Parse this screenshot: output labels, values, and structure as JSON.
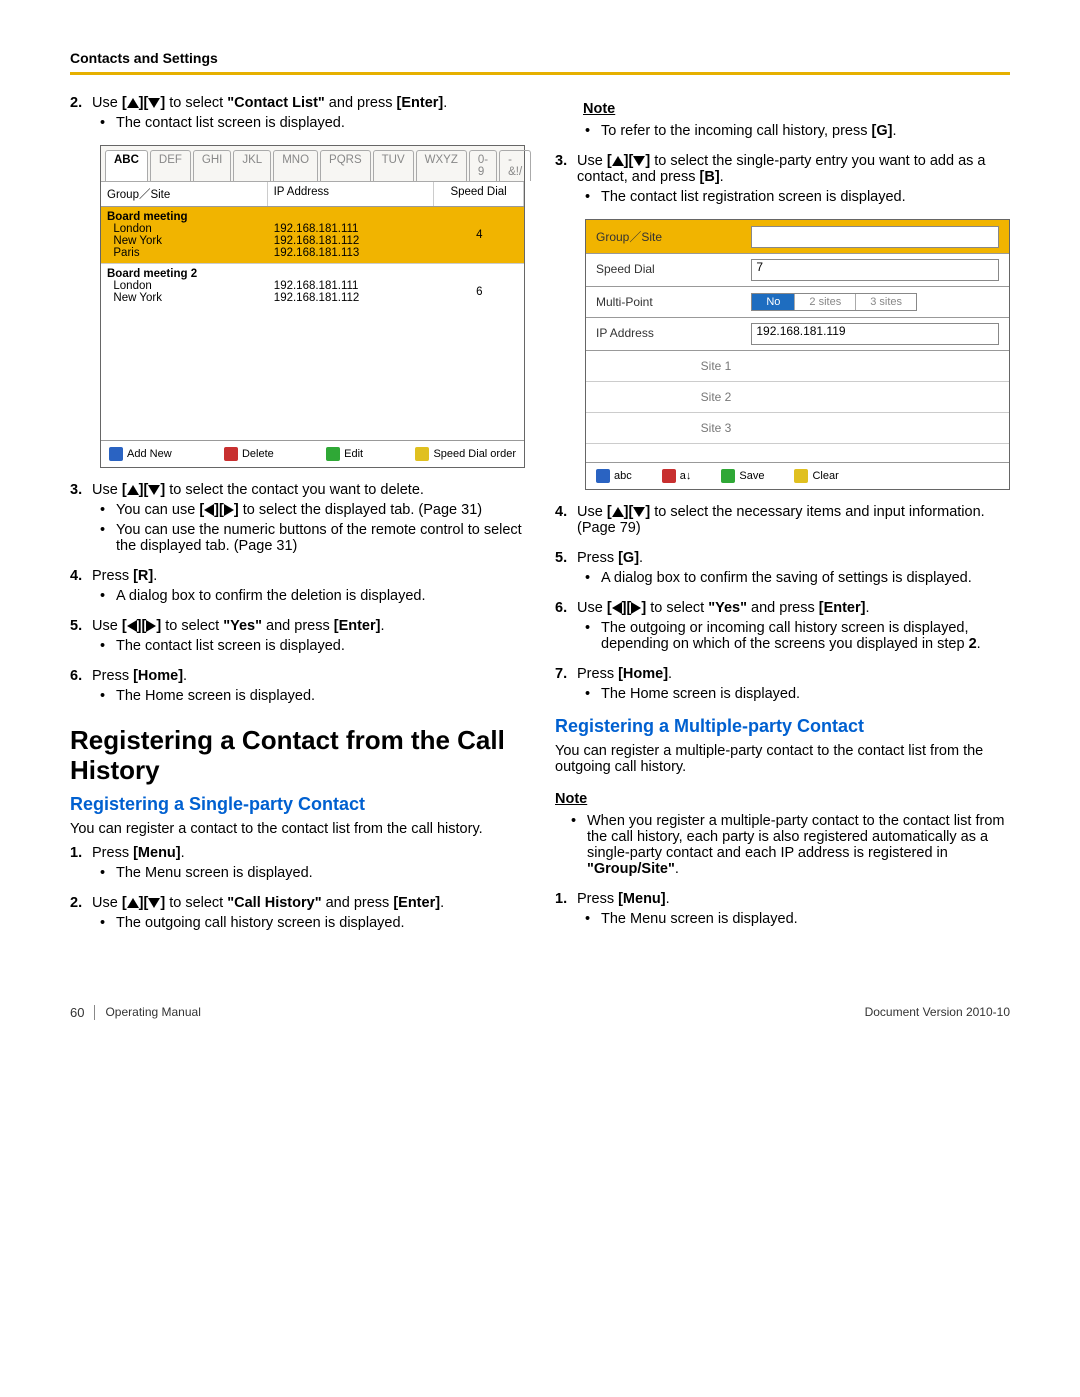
{
  "header": {
    "section_title": "Contacts and Settings"
  },
  "arrows": {
    "up": "▲",
    "down": "▼",
    "left": "◀",
    "right": "▶"
  },
  "left": {
    "step2": {
      "num": "2.",
      "pre": "Use ",
      "mid": " to select ",
      "target": "\"Contact List\"",
      "post": " and press ",
      "key": "[Enter]",
      "end": "."
    },
    "step2_bullet": "The contact list screen is displayed.",
    "ss1": {
      "tabs": [
        "ABC",
        "DEF",
        "GHI",
        "JKL",
        "MNO",
        "PQRS",
        "TUV",
        "WXYZ",
        "0-9",
        "-&!/"
      ],
      "cols": [
        "Group／Site",
        "IP Address",
        "Speed Dial"
      ],
      "row1": {
        "group": "Board meeting",
        "sites": [
          "London",
          "New York",
          "Paris"
        ],
        "ips": [
          "192.168.181.111",
          "192.168.181.112",
          "192.168.181.113"
        ],
        "sd": "4"
      },
      "row2": {
        "group": "Board meeting 2",
        "sites": [
          "London",
          "New York"
        ],
        "ips": [
          "192.168.181.111",
          "192.168.181.112"
        ],
        "sd": "6"
      },
      "btns": {
        "b": "Add New",
        "r": "Delete",
        "g": "Edit",
        "y": "Speed Dial order"
      }
    },
    "step3": {
      "num": "3.",
      "pre": "Use ",
      "post": " to select the contact you want to delete."
    },
    "step3_b1_pre": "You can use ",
    "step3_b1_post": " to select the displayed tab. (Page 31)",
    "step3_b2": "You can use the numeric buttons of the remote control to select the displayed tab. (Page 31)",
    "step4": {
      "num": "4.",
      "text": "Press ",
      "key": "[R]",
      "end": "."
    },
    "step4_b": "A dialog box to confirm the deletion is displayed.",
    "step5": {
      "num": "5.",
      "pre": "Use ",
      "mid": " to select ",
      "target": "\"Yes\"",
      "post": " and press ",
      "key": "[Enter]",
      "end": "."
    },
    "step5_b": "The contact list screen is displayed.",
    "step6": {
      "num": "6.",
      "text": "Press ",
      "key": "[Home]",
      "end": "."
    },
    "step6_b": "The Home screen is displayed.",
    "h1": "Registering a Contact from the Call History",
    "h2": "Registering a Single-party Contact",
    "intro": "You can register a contact to the contact list from the call history.",
    "s1": {
      "num": "1.",
      "text": "Press ",
      "key": "[Menu]",
      "end": "."
    },
    "s1_b": "The Menu screen is displayed.",
    "s2": {
      "num": "2.",
      "pre": "Use ",
      "mid": " to select ",
      "target": "\"Call History\"",
      "post": " and press ",
      "key": "[Enter]",
      "end": "."
    },
    "s2_b": "The outgoing call history screen is displayed."
  },
  "right": {
    "note": "Note",
    "note_b_pre": "To refer to the incoming call history, press ",
    "note_b_key": "[G]",
    "note_b_end": ".",
    "step3": {
      "num": "3.",
      "pre": "Use ",
      "mid": " to select the single-party entry you want to add as a contact, and press ",
      "key": "[B]",
      "end": "."
    },
    "step3_b": "The contact list registration screen is displayed.",
    "ss2": {
      "rows": [
        {
          "label": "Group／Site",
          "val": ""
        },
        {
          "label": "Speed Dial",
          "val": "7"
        },
        {
          "label": "Multi-Point",
          "seg": [
            "No",
            "2 sites",
            "3 sites"
          ]
        },
        {
          "label": "IP Address",
          "val": "192.168.181.119"
        }
      ],
      "sites": [
        "Site 1",
        "Site 2",
        "Site 3"
      ],
      "btns": {
        "b": "abc",
        "r": "a↓",
        "g": "Save",
        "y": "Clear"
      }
    },
    "step4": {
      "num": "4.",
      "pre": "Use ",
      "post": " to select the necessary items and input information. (Page 79)"
    },
    "step5": {
      "num": "5.",
      "text": "Press ",
      "key": "[G]",
      "end": "."
    },
    "step5_b": "A dialog box to confirm the saving of settings is displayed.",
    "step6": {
      "num": "6.",
      "pre": "Use ",
      "mid": " to select ",
      "target": "\"Yes\"",
      "post": " and press ",
      "key": "[Enter]",
      "end": "."
    },
    "step6_b": "The outgoing or incoming call history screen is displayed, depending on which of the screens you displayed in step ",
    "step6_b_key": "2",
    "step6_b_end": ".",
    "step7": {
      "num": "7.",
      "text": "Press ",
      "key": "[Home]",
      "end": "."
    },
    "step7_b": "The Home screen is displayed.",
    "h2": "Registering a Multiple-party Contact",
    "intro": "You can register a multiple-party contact to the contact list from the outgoing call history.",
    "note2": "Note",
    "note2_b": "When you register a multiple-party contact to the contact list from the call history, each party is also registered automatically as a single-party contact and each IP address is registered in ",
    "note2_key": "\"Group/Site\"",
    "note2_end": ".",
    "s1": {
      "num": "1.",
      "text": "Press ",
      "key": "[Menu]",
      "end": "."
    },
    "s1_b": "The Menu screen is displayed."
  },
  "footer": {
    "page": "60",
    "manual": "Operating Manual",
    "docver": "Document Version  2010-10"
  }
}
